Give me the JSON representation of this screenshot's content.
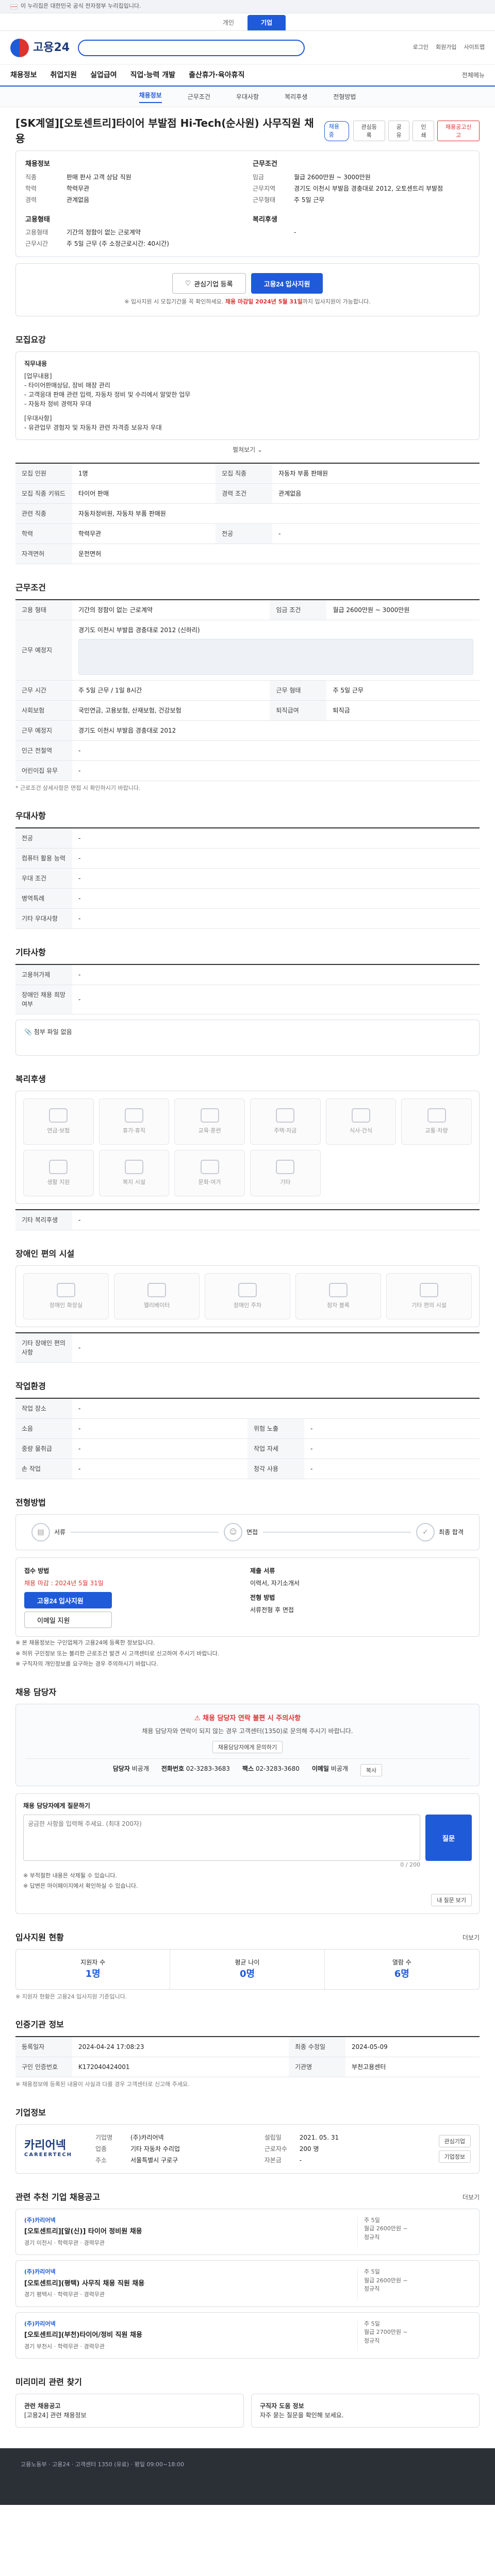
{
  "gov_top": "이 누리집은 대한민국 공식 전자정부 누리집입니다.",
  "top_tabs": [
    "개인",
    "기업"
  ],
  "logo": "고용24",
  "header_links": [
    "로그인",
    "회원가입",
    "사이트맵"
  ],
  "gnb": [
    "채용정보",
    "취업지원",
    "실업급여",
    "직업·능력 개발",
    "출산휴가·육아휴직"
  ],
  "gnb_all": "전체메뉴",
  "subnav": [
    "채용정보",
    "근무조건",
    "우대사항",
    "복리후생",
    "전형방법"
  ],
  "subnav_active": 0,
  "job": {
    "title": "[SK계열][오토센트리]타이어 부발점 Hi-Tech(순사원) 사무직원 채용",
    "badge": "채용중",
    "actions": [
      "관심등록",
      "공유",
      "인쇄",
      "채용공고신고"
    ]
  },
  "summary": {
    "left_title": "채용정보",
    "left": [
      {
        "k": "직종",
        "v": "판매 판사 고객 상담 직원"
      },
      {
        "k": "학력",
        "v": "학력무관"
      },
      {
        "k": "경력",
        "v": "관계없음"
      }
    ],
    "right_title": "근무조건",
    "right": [
      {
        "k": "임금",
        "v": "월급 2600만원 ~ 3000만원"
      },
      {
        "k": "근무지역",
        "v": "경기도 이천시 부발읍 경충대로 2012, 오토센트리 부발점"
      },
      {
        "k": "근무형태",
        "v": "주 5일 근무"
      }
    ],
    "left2_title": "고용형태",
    "left2": [
      {
        "k": "고용형태",
        "v": "기간의 정함이 없는 근로계약"
      },
      {
        "k": "근무시간",
        "v": "주 5일 근무 (주 소정근로시간: 40시간)"
      }
    ],
    "right2_title": "복리후생",
    "right2": [
      {
        "k": "",
        "v": "-"
      }
    ]
  },
  "apply": {
    "interest": "관심기업 등록",
    "apply": "고용24 입사지원",
    "note_pre": "※ 입사지원 시 모집기간을 꼭 확인하세요.",
    "note_b": "채용 마감일 2024년 5월 31일",
    "note_post": "까지 입사지원이 가능합니다."
  },
  "job_content": {
    "title": "모집요강",
    "heading": "직무내용",
    "lines": [
      "[업무내용]",
      "- 타이어판매상담, 장비 매장 관리",
      "- 고객응대 판매 관련 입력, 자동차 정비 및 수리에서 알맞한 업무",
      "- 자동차 정비 경력자 우대",
      "",
      "[우대사항]",
      "- 유관업무 경험자 및 자동차 관련 자격증 보유자 우대"
    ],
    "more": "펼쳐보기"
  },
  "recruit_table": [
    {
      "k": "모집 인원",
      "v": "1명",
      "k2": "모집 직종",
      "v2": "자동차 부품 판매원"
    },
    {
      "k": "모집 직종 키워드",
      "v": "타이어 판매",
      "k2": "경력 조건",
      "v2": "관계없음"
    },
    {
      "k": "관련 직종",
      "v": "자동차정비원, 자동차 부품 판매원",
      "k2": "",
      "v2": ""
    },
    {
      "k": "학력",
      "v": "학력무관",
      "k2": "전공",
      "v2": "-"
    },
    {
      "k": "자격면허",
      "v": "운전면허",
      "k2": "",
      "v2": ""
    }
  ],
  "work": {
    "title": "근무조건",
    "rows": [
      {
        "k": "고용 형태",
        "v": "기간의 정함이 없는 근로계약",
        "k2": "임금 조건",
        "v2": "월급 2600만원 ~ 3000만원"
      },
      {
        "k": "근무 예정지",
        "v": "경기도 이천시 부발읍 경충대로 2012 (신하리)",
        "k2": "",
        "v2": ""
      },
      {
        "k": "근무 시간",
        "v": "주 5일 근무 / 1일 8시간",
        "k2": "근무 형태",
        "v2": "주 5일 근무"
      },
      {
        "k": "사회보험",
        "v": "국민연금, 고용보험, 산재보험, 건강보험",
        "k2": "퇴직급여",
        "v2": "퇴직금"
      },
      {
        "k": "근무 예정지",
        "v": "경기도 이천시 부발읍 경충대로 2012",
        "k2": "",
        "v2": ""
      },
      {
        "k": "인근 전철역",
        "v": "-",
        "k2": "",
        "v2": ""
      },
      {
        "k": "어린이집 유무",
        "v": "-",
        "k2": "",
        "v2": ""
      }
    ],
    "note": "* 근로조건 상세사항은 면접 시 확인하시기 바랍니다."
  },
  "pref": {
    "title": "우대사항",
    "rows": [
      {
        "k": "전공",
        "v": "-"
      },
      {
        "k": "컴퓨터 활용 능력",
        "v": "-"
      },
      {
        "k": "우대 조건",
        "v": "-"
      },
      {
        "k": "병역특례",
        "v": "-"
      },
      {
        "k": "기타 우대사항",
        "v": "-"
      }
    ]
  },
  "extra": {
    "title": "기타사항",
    "rows": [
      {
        "k": "고용허가제",
        "v": "-"
      },
      {
        "k": "장애인 채용 희망 여부",
        "v": "-"
      }
    ],
    "attach_label": "첨부 파일 없음"
  },
  "welfare": {
    "title": "복리후생",
    "items": [
      "연금·보험",
      "휴가·휴직",
      "교육·훈련",
      "주택·자금",
      "식사·간식",
      "교통·차량",
      "생활 지원",
      "복지 시설",
      "문화·여가",
      "기타"
    ],
    "other_label": "기타 복리후생",
    "other_value": "-"
  },
  "disabled": {
    "title": "장애인 편의 시설",
    "items": [
      "장애인 화장실",
      "엘리베이터",
      "장애인 주차",
      "점자 블록",
      "기타 편의 시설"
    ],
    "other_label": "기타 장애인 편의사항",
    "other_value": "-"
  },
  "workplace": {
    "title": "작업환경",
    "rows": [
      {
        "k": "작업 장소",
        "v": "-",
        "k2": "",
        "v2": ""
      },
      {
        "k": "소음",
        "v": "-",
        "k2": "위험 노출",
        "v2": "-"
      },
      {
        "k": "중량 물취급",
        "v": "-",
        "k2": "작업 자세",
        "v2": "-"
      },
      {
        "k": "손 작업",
        "v": "-",
        "k2": "청각 사용",
        "v2": "-"
      }
    ]
  },
  "process": {
    "title": "전형방법",
    "steps": [
      "서류",
      "면접",
      "최종 합격"
    ]
  },
  "method": {
    "receive_title": "접수 방법",
    "receive": "채용 마감 : 2024년 5월 31일",
    "apply_btn": "고용24 입사지원",
    "email_btn": "이메일 지원",
    "doc_title": "제출 서류",
    "doc": "이력서, 자기소개서",
    "doc_title2": "전형 방법",
    "doc2": "서류전형 후 면접",
    "bullets": [
      "※ 본 채용정보는 구인업체가 고용24에 등록한 정보입니다.",
      "※ 허위 구인정보 또는 불리한 근로조건 발견 시 고객센터로 신고하여 주시기 바랍니다.",
      "※ 구직자의 개인정보를 요구하는 경우 주의하시기 바랍니다."
    ]
  },
  "contact": {
    "title": "채용 담당자",
    "warn": "채용 담당자 연락 불편 시 주의사항",
    "desc": "채용 담당자와 연락이 되지 않는 경우 고객센터(1350)로 문의해 주시기 바랍니다.",
    "btn": "채용담당자에게 문의하기",
    "manager_label": "담당자",
    "manager": "비공개",
    "phone_label": "전화번호",
    "phone": "02-3283-3683",
    "fax_label": "팩스",
    "fax": "02-3283-3680",
    "email_label": "이메일",
    "email": "비공개",
    "copy_btn": "복사"
  },
  "inquiry": {
    "title": "채용 담당자에게 질문하기",
    "placeholder": "궁금한 사항을 입력해 주세요. (최대 200자)",
    "submit": "질문",
    "count": "0 / 200",
    "notes": [
      "※ 부적절한 내용은 삭제될 수 있습니다.",
      "※ 답변은 마이페이지에서 확인하실 수 있습니다."
    ],
    "history_btn": "내 질문 보기"
  },
  "applicants": {
    "title": "입사지원 현황",
    "more": "더보기",
    "items": [
      {
        "label": "지원자 수",
        "value": "1명"
      },
      {
        "label": "평균 나이",
        "value": "0명"
      },
      {
        "label": "열람 수",
        "value": "6명"
      }
    ],
    "note": "※ 지원자 현황은 고용24 입사지원 기준입니다."
  },
  "receipt": {
    "title": "인증기관 정보",
    "rows": [
      {
        "k": "등록일자",
        "v": "2024-04-24 17:08:23",
        "k2": "최종 수정일",
        "v2": "2024-05-09"
      },
      {
        "k": "구인 인증번호",
        "v": "K172040424001",
        "k2": "기관명",
        "v2": "부천고용센터"
      }
    ],
    "note": "※ 채용정보에 등록된 내용이 사실과 다를 경우 고객센터로 신고해 주세요."
  },
  "company": {
    "title": "기업정보",
    "logo_main": "카리어넥",
    "logo_sub": "CAREERTECH",
    "info": [
      {
        "k": "기업명",
        "v": "(주)카리어넥"
      },
      {
        "k": "설립일",
        "v": "2021. 05. 31"
      },
      {
        "k": "업종",
        "v": "기타 자동차 수리업"
      },
      {
        "k": "근로자수",
        "v": "200 명"
      },
      {
        "k": "주소",
        "v": "서울특별시 구로구"
      },
      {
        "k": "자본금",
        "v": "-"
      }
    ],
    "btns": [
      "관심기업",
      "기업정보"
    ]
  },
  "related": {
    "title": "관련 추천 기업 채용공고",
    "more": "더보기",
    "jobs": [
      {
        "co": "(주)카리어넥",
        "title": "[오토센트리][알(신)] 타이어 정비원 채용",
        "meta": "경기 이천시 · 학력무관 · 경력무관",
        "side": [
          "주 5일",
          "월급 2600만원 ~",
          "정규직"
        ]
      },
      {
        "co": "(주)카리어넥",
        "title": "[오토센트리](평택) 사무직 채용 직원 채용",
        "meta": "경기 평택시 · 학력무관 · 경력무관",
        "side": [
          "주 5일",
          "월급 2600만원 ~",
          "정규직"
        ]
      },
      {
        "co": "(주)카리어넥",
        "title": "[오토센트리](부천)타이어/정비 직원 채용",
        "meta": "경기 부천시 · 학력무관 · 경력무관",
        "side": [
          "주 5일",
          "월급 2700만원 ~",
          "정규직"
        ]
      }
    ]
  },
  "bottom": {
    "title": "미리미리 관련 찾기",
    "left_head": "관련 채용공고",
    "left_item": "[고용24] 관련 채용정보",
    "right_head": "구직자 도움 정보",
    "right_item": "자주 묻는 질문을 확인해 보세요."
  },
  "footer": "고용노동부 · 고용24 · 고객센터 1350 (유료) · 평일 09:00~18:00"
}
